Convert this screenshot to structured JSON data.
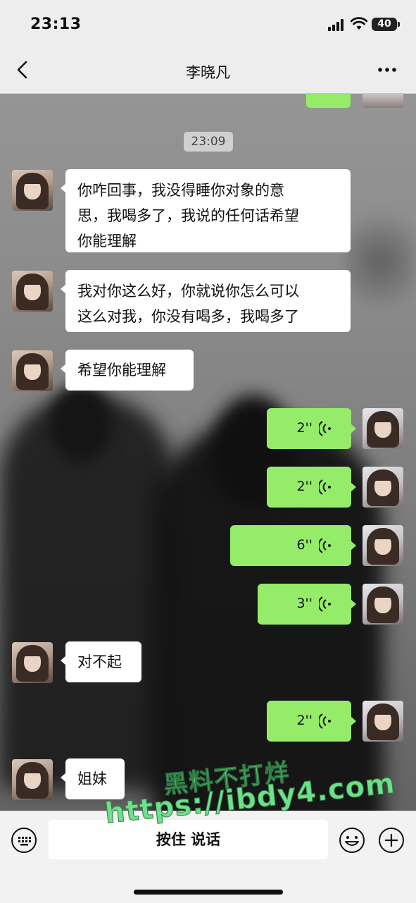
{
  "status_bar": {
    "time": "23:13",
    "battery": "40"
  },
  "header": {
    "title": "李晓凡",
    "back_icon": "chevron-left-icon",
    "more_icon": "ellipsis-icon"
  },
  "chat": {
    "timestamp": "23:09",
    "incoming": [
      {
        "lines": [
          "你咋回事，我没得睡你对象的意",
          "思，我喝多了，我说的任何话希望",
          "你能理解"
        ]
      },
      {
        "lines": [
          "我对你这么好，你就说你怎么可以",
          "这么对我，你没有喝多，我喝多了"
        ]
      },
      {
        "lines": [
          "希望你能理解"
        ]
      },
      {
        "lines": [
          "对不起"
        ]
      },
      {
        "lines": [
          "姐妹"
        ]
      }
    ],
    "voice_messages": [
      {
        "duration": "2''"
      },
      {
        "duration": "2''"
      },
      {
        "duration": "6''"
      },
      {
        "duration": "3''"
      },
      {
        "duration": "2''"
      }
    ]
  },
  "watermark": {
    "line1": "黑料不打烊",
    "line2": "https://ibdy4.com"
  },
  "input_bar": {
    "hold_to_talk": "按住 说话",
    "keyboard_icon": "keyboard-icon",
    "emoji_icon": "emoji-icon",
    "plus_icon": "plus-icon"
  },
  "colors": {
    "voice_bubble": "#95ec69",
    "incoming_bubble": "#ffffff",
    "header_bg": "#ededed"
  }
}
